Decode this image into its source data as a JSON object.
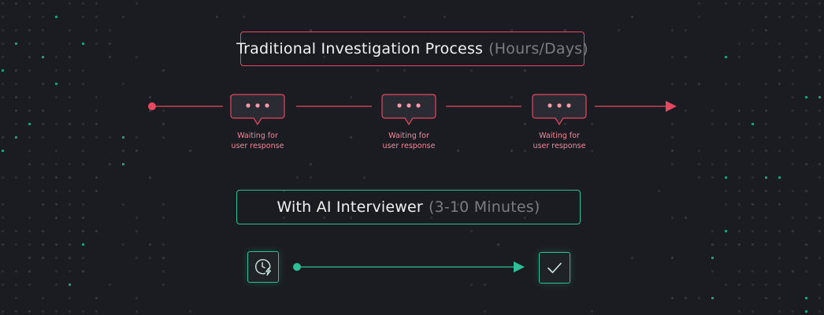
{
  "colors": {
    "background": "#1b1c21",
    "traditional_accent": "#e5485f",
    "ai_accent": "#2fbf98",
    "label_text": "#f08a9a",
    "muted_text": "#7b7c84"
  },
  "traditional": {
    "title": "Traditional Investigation Process",
    "duration": "(Hours/Days)",
    "steps": [
      {
        "icon": "speech-bubble-ellipsis-icon",
        "label_line1": "Waiting for",
        "label_line2": "user response"
      },
      {
        "icon": "speech-bubble-ellipsis-icon",
        "label_line1": "Waiting for",
        "label_line2": "user response"
      },
      {
        "icon": "speech-bubble-ellipsis-icon",
        "label_line1": "Waiting for",
        "label_line2": "user response"
      }
    ]
  },
  "ai": {
    "title": "With AI Interviewer",
    "duration": "(3-10 Minutes)",
    "start_icon": "clock-lightning-icon",
    "end_icon": "checkmark-icon"
  }
}
